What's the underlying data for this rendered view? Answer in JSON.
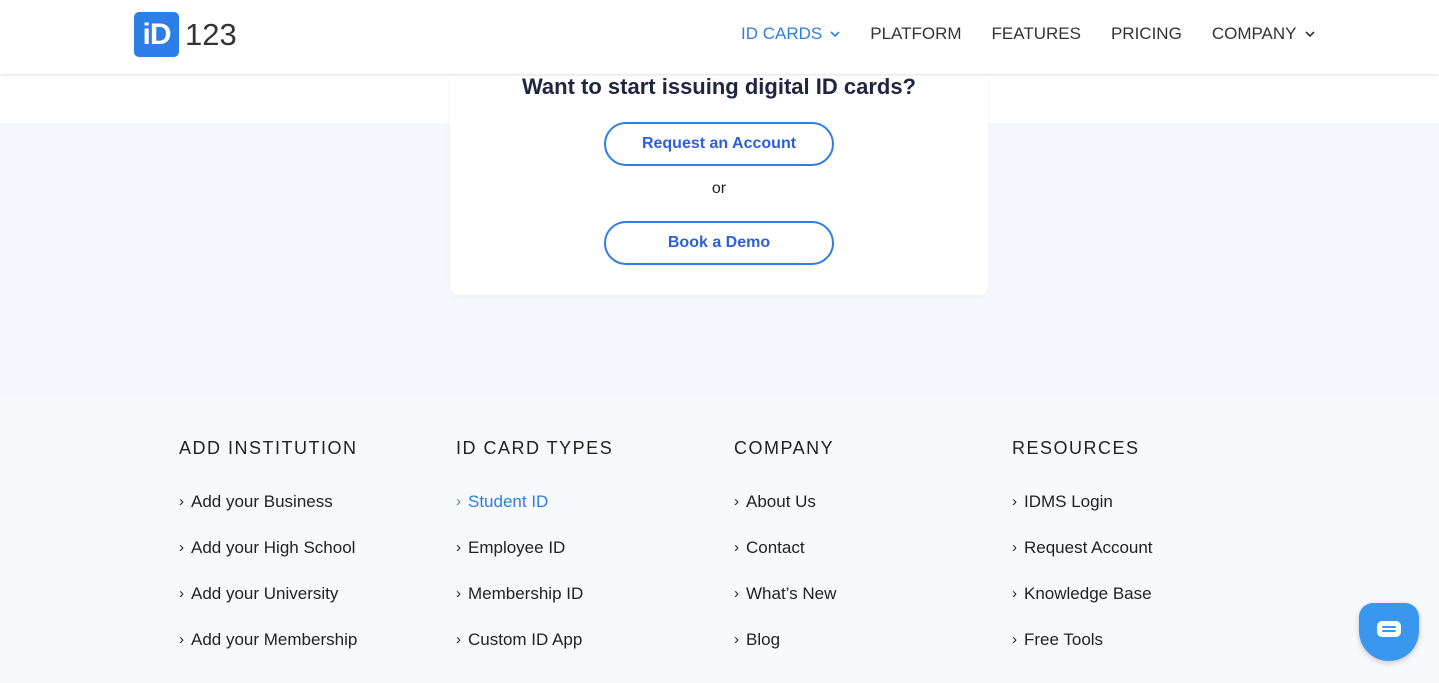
{
  "header": {
    "logo_text": "123",
    "logo_mark": "iD",
    "nav": [
      {
        "label": "ID CARDS",
        "dropdown": true,
        "active": true
      },
      {
        "label": "PLATFORM",
        "dropdown": false
      },
      {
        "label": "FEATURES",
        "dropdown": false
      },
      {
        "label": "PRICING",
        "dropdown": false
      },
      {
        "label": "COMPANY",
        "dropdown": true
      }
    ]
  },
  "cta": {
    "title": "Want to start issuing digital ID cards?",
    "request_label": "Request an Account",
    "or_label": "or",
    "demo_label": "Book a Demo"
  },
  "footer": {
    "columns": [
      {
        "title": "ADD INSTITUTION",
        "items": [
          "Add your Business",
          "Add your High School",
          "Add your University",
          "Add your Membership"
        ]
      },
      {
        "title": "ID CARD TYPES",
        "items": [
          "Student ID",
          "Employee ID",
          "Membership ID",
          "Custom ID App"
        ]
      },
      {
        "title": "COMPANY",
        "items": [
          "About Us",
          "Contact",
          "What’s New",
          "Blog"
        ]
      },
      {
        "title": "RESOURCES",
        "items": [
          "IDMS Login",
          "Request Account",
          "Knowledge Base",
          "Free Tools"
        ]
      }
    ]
  },
  "colors": {
    "accent": "#2d7ee6",
    "chat": "#3a97f0",
    "band": "#f5f7fc"
  },
  "chat": {
    "icon": "chat-icon"
  }
}
